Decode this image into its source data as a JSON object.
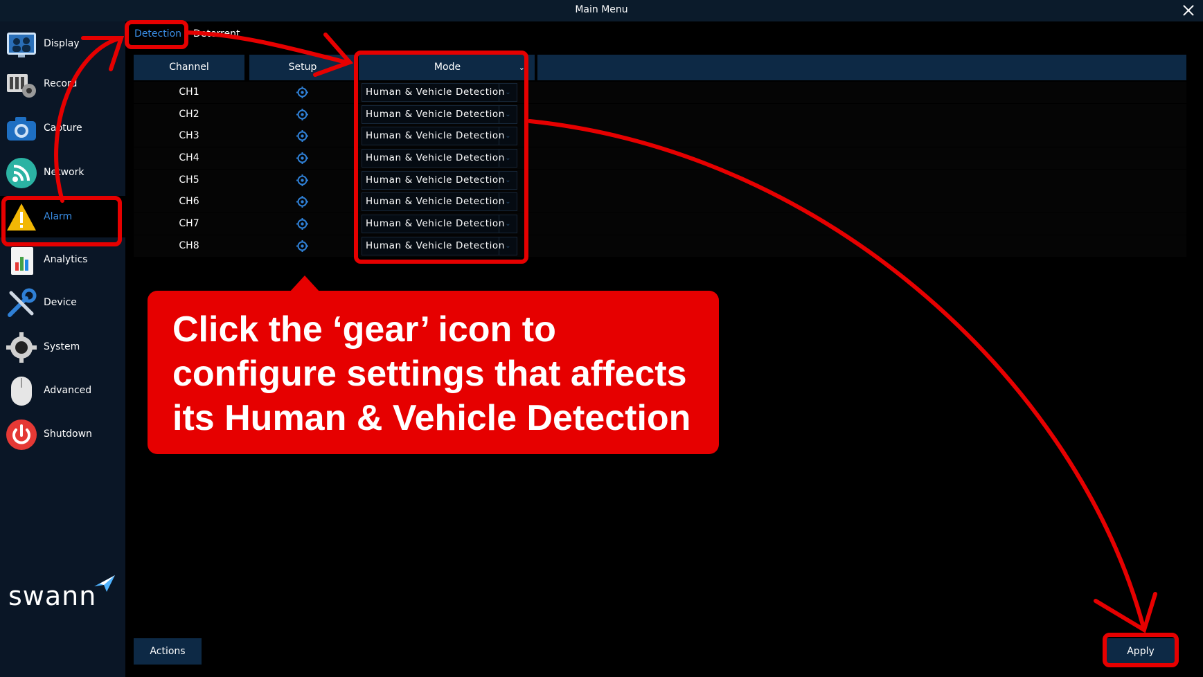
{
  "window": {
    "title": "Main  Menu"
  },
  "sidebar": {
    "items": [
      {
        "label": "Display",
        "icon": "display-icon",
        "active": false
      },
      {
        "label": "Record",
        "icon": "record-icon",
        "active": false
      },
      {
        "label": "Capture",
        "icon": "camera-icon",
        "active": false
      },
      {
        "label": "Network",
        "icon": "network-icon",
        "active": false
      },
      {
        "label": "Alarm",
        "icon": "warning-icon",
        "active": true
      },
      {
        "label": "Analytics",
        "icon": "analytics-icon",
        "active": false
      },
      {
        "label": "Device",
        "icon": "tools-icon",
        "active": false
      },
      {
        "label": "System",
        "icon": "gear-icon",
        "active": false
      },
      {
        "label": "Advanced",
        "icon": "mouse-icon",
        "active": false
      },
      {
        "label": "Shutdown",
        "icon": "power-icon",
        "active": false
      }
    ],
    "logo": "swann"
  },
  "tabs": [
    {
      "label": "Detection",
      "active": true
    },
    {
      "label": "Deterrent",
      "active": false
    }
  ],
  "table": {
    "headers": {
      "channel": "Channel",
      "setup": "Setup",
      "mode": "Mode"
    },
    "rows": [
      {
        "channel": "CH1",
        "mode": "Human & Vehicle Detection"
      },
      {
        "channel": "CH2",
        "mode": "Human & Vehicle Detection"
      },
      {
        "channel": "CH3",
        "mode": "Human & Vehicle Detection"
      },
      {
        "channel": "CH4",
        "mode": "Human & Vehicle Detection"
      },
      {
        "channel": "CH5",
        "mode": "Human & Vehicle Detection"
      },
      {
        "channel": "CH6",
        "mode": "Human & Vehicle Detection"
      },
      {
        "channel": "CH7",
        "mode": "Human & Vehicle Detection"
      },
      {
        "channel": "CH8",
        "mode": "Human & Vehicle Detection"
      }
    ]
  },
  "buttons": {
    "actions": "Actions",
    "apply": "Apply"
  },
  "annotation": {
    "callout_text": "Click the ‘gear’ icon to configure settings that affects its Human & Vehicle Detection",
    "color": "#e60000"
  },
  "colors": {
    "accent": "#3a8ee6",
    "header_bg": "#0d2945",
    "sidebar_bg": "#0a1626",
    "titlebar_bg": "#0b1b2b"
  }
}
